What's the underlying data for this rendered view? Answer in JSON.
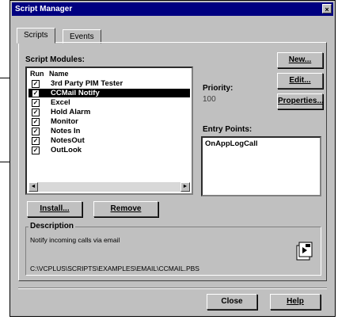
{
  "window": {
    "title": "Script Manager",
    "close_glyph": "×"
  },
  "tabs": [
    {
      "label": "Scripts"
    },
    {
      "label": "Events"
    }
  ],
  "modules": {
    "label": "Script Modules:",
    "columns": {
      "run": "Run",
      "name": "Name"
    },
    "items": [
      {
        "name": "3rd Party PIM Tester",
        "checked": true,
        "selected": false
      },
      {
        "name": "CCMail Notify",
        "checked": true,
        "selected": true
      },
      {
        "name": "Excel",
        "checked": true,
        "selected": false
      },
      {
        "name": "Hold Alarm",
        "checked": true,
        "selected": false
      },
      {
        "name": "Monitor",
        "checked": true,
        "selected": false
      },
      {
        "name": "Notes In",
        "checked": true,
        "selected": false
      },
      {
        "name": "NotesOut",
        "checked": true,
        "selected": false
      },
      {
        "name": "OutLook",
        "checked": true,
        "selected": false
      }
    ],
    "check_glyph": "✓"
  },
  "priority": {
    "label": "Priority:",
    "value": "100"
  },
  "entry_points": {
    "label": "Entry Points:",
    "items": [
      "OnAppLogCall"
    ]
  },
  "buttons": {
    "new": "New...",
    "edit": "Edit...",
    "properties": "Properties...",
    "install": "Install...",
    "remove": "Remove",
    "close": "Close",
    "help": "Help"
  },
  "description": {
    "label": "Description",
    "text": "Notify incoming calls via email",
    "path": "C:\\VCPLUS\\SCRIPTS\\EXAMPLES\\EMAIL\\CCMAIL.PBS"
  },
  "scroll_glyphs": {
    "left": "◄",
    "right": "►"
  }
}
